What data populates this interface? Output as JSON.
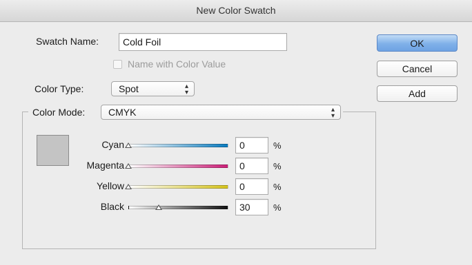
{
  "window": {
    "title": "New Color Swatch"
  },
  "swatch_name": {
    "label": "Swatch Name:",
    "value": "Cold Foil"
  },
  "name_with_color_value": {
    "label": "Name with Color Value",
    "checked": false,
    "enabled": false
  },
  "color_type": {
    "label": "Color Type:",
    "value": "Spot"
  },
  "color_mode": {
    "label": "Color Mode:",
    "value": "CMYK"
  },
  "buttons": {
    "ok": "OK",
    "cancel": "Cancel",
    "add": "Add"
  },
  "channels": [
    {
      "name": "Cyan",
      "value": "0",
      "unit": "%",
      "level": 0,
      "gradient_end": "#0a7cc0"
    },
    {
      "name": "Magenta",
      "value": "0",
      "unit": "%",
      "level": 0,
      "gradient_end": "#cc1f78"
    },
    {
      "name": "Yellow",
      "value": "0",
      "unit": "%",
      "level": 0,
      "gradient_end": "#d6c41c"
    },
    {
      "name": "Black",
      "value": "30",
      "unit": "%",
      "level": 0.3,
      "gradient_end": "#111111"
    }
  ],
  "preview_color": "#c4c4c4"
}
